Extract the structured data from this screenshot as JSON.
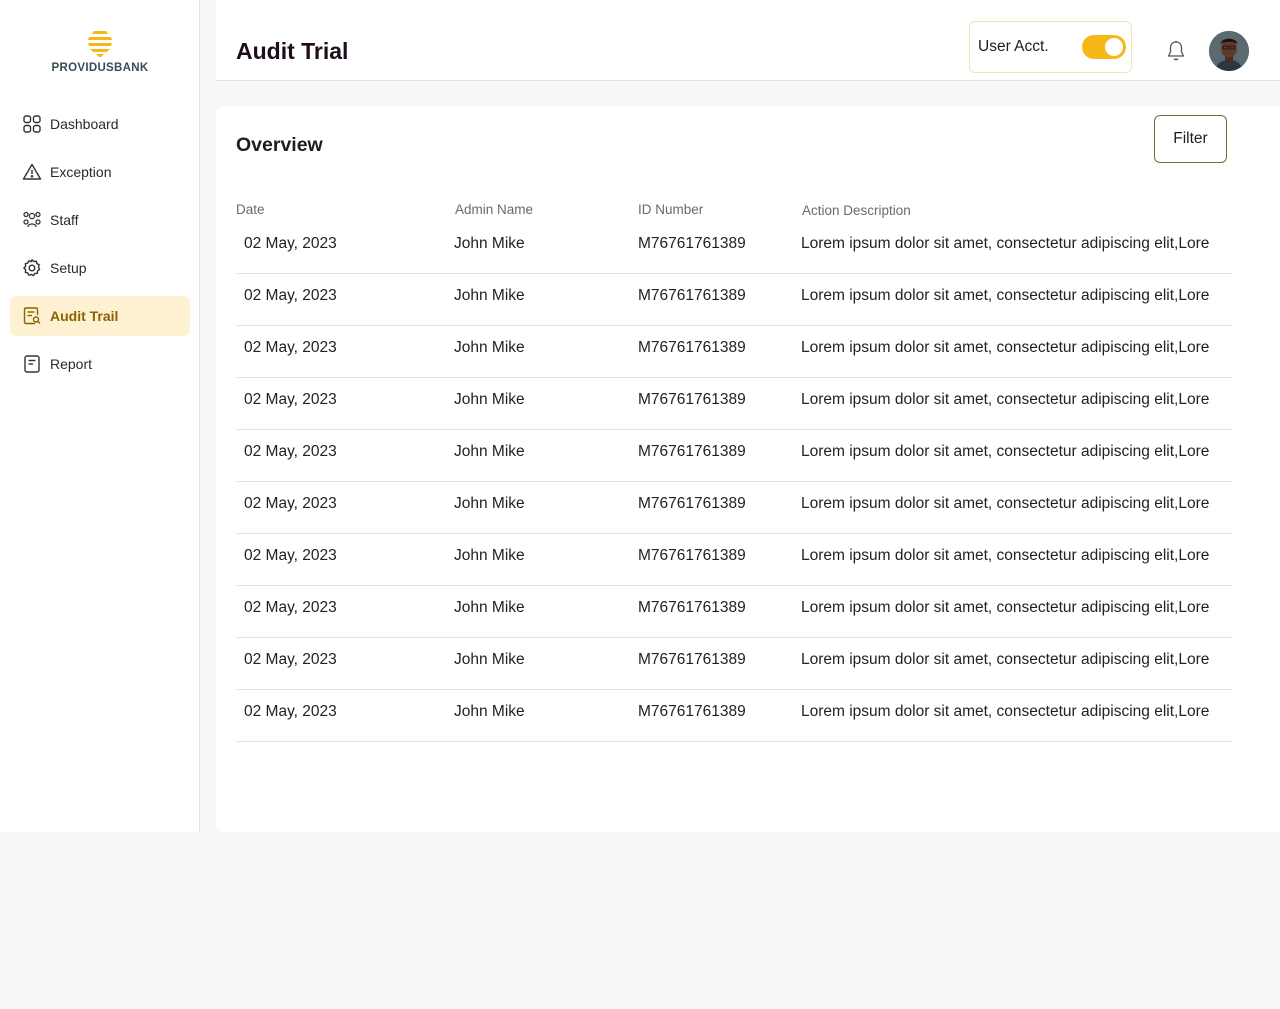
{
  "brand": {
    "name": "PROVIDUSBANK",
    "color": "#f6b816"
  },
  "sidebar": {
    "items": [
      {
        "label": "Dashboard",
        "icon": "dashboard-icon",
        "active": false
      },
      {
        "label": "Exception",
        "icon": "warning-icon",
        "active": false
      },
      {
        "label": "Staff",
        "icon": "staff-icon",
        "active": false
      },
      {
        "label": "Setup",
        "icon": "gear-icon",
        "active": false
      },
      {
        "label": "Audit Trail",
        "icon": "audit-icon",
        "active": true
      },
      {
        "label": "Report",
        "icon": "report-icon",
        "active": false
      }
    ]
  },
  "header": {
    "title": "Audit Trial",
    "user_acct_label": "User Acct.",
    "toggle_on": true
  },
  "main": {
    "overview_title": "Overview",
    "filter_label": "Filter",
    "table": {
      "columns": [
        "Date",
        "Admin Name",
        "ID Number",
        "Action Description"
      ],
      "rows": [
        [
          "02 May, 2023",
          "John Mike",
          "M76761761389",
          "Lorem ipsum dolor sit amet, consectetur adipiscing elit,Lore"
        ],
        [
          "02 May, 2023",
          "John Mike",
          "M76761761389",
          "Lorem ipsum dolor sit amet, consectetur adipiscing elit,Lore"
        ],
        [
          "02 May, 2023",
          "John Mike",
          "M76761761389",
          "Lorem ipsum dolor sit amet, consectetur adipiscing elit,Lore"
        ],
        [
          "02 May, 2023",
          "John Mike",
          "M76761761389",
          "Lorem ipsum dolor sit amet, consectetur adipiscing elit,Lore"
        ],
        [
          "02 May, 2023",
          "John Mike",
          "M76761761389",
          "Lorem ipsum dolor sit amet, consectetur adipiscing elit,Lore"
        ],
        [
          "02 May, 2023",
          "John Mike",
          "M76761761389",
          "Lorem ipsum dolor sit amet, consectetur adipiscing elit,Lore"
        ],
        [
          "02 May, 2023",
          "John Mike",
          "M76761761389",
          "Lorem ipsum dolor sit amet, consectetur adipiscing elit,Lore"
        ],
        [
          "02 May, 2023",
          "John Mike",
          "M76761761389",
          "Lorem ipsum dolor sit amet, consectetur adipiscing elit,Lore"
        ],
        [
          "02 May, 2023",
          "John Mike",
          "M76761761389",
          "Lorem ipsum dolor sit amet, consectetur adipiscing elit,Lore"
        ],
        [
          "02 May, 2023",
          "John Mike",
          "M76761761389",
          "Lorem ipsum dolor sit amet, consectetur adipiscing elit,Lore"
        ]
      ]
    }
  },
  "colors": {
    "accent": "#f6b816",
    "active_bg": "#fdf1d2",
    "active_text": "#8a6200",
    "title": "#1e0d1a"
  }
}
